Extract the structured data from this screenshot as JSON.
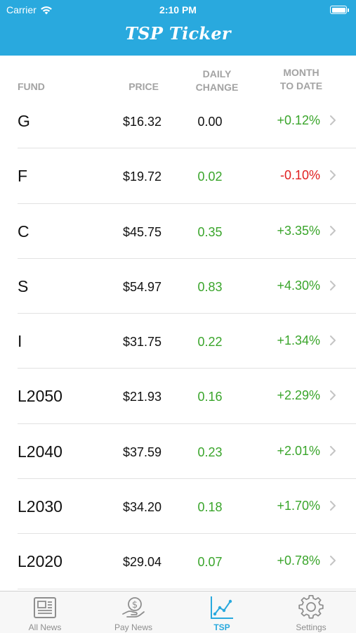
{
  "status_bar": {
    "carrier": "Carrier",
    "time": "2:10 PM"
  },
  "nav": {
    "title": "TSP Ticker"
  },
  "colors": {
    "brand": "#29a9de",
    "positive": "#3aa52b",
    "negative": "#e02020",
    "neutral": "#111111"
  },
  "table": {
    "headers": {
      "fund": "FUND",
      "price": "PRICE",
      "daily_line1": "DAILY",
      "daily_line2": "CHANGE",
      "month_line1": "MONTH",
      "month_line2": "TO DATE"
    },
    "rows": [
      {
        "fund": "G",
        "price": "$16.32",
        "daily": "0.00",
        "daily_trend": "neutral",
        "month": "+0.12%",
        "month_trend": "positive"
      },
      {
        "fund": "F",
        "price": "$19.72",
        "daily": "0.02",
        "daily_trend": "positive",
        "month": "-0.10%",
        "month_trend": "negative"
      },
      {
        "fund": "C",
        "price": "$45.75",
        "daily": "0.35",
        "daily_trend": "positive",
        "month": "+3.35%",
        "month_trend": "positive"
      },
      {
        "fund": "S",
        "price": "$54.97",
        "daily": "0.83",
        "daily_trend": "positive",
        "month": "+4.30%",
        "month_trend": "positive"
      },
      {
        "fund": "I",
        "price": "$31.75",
        "daily": "0.22",
        "daily_trend": "positive",
        "month": "+1.34%",
        "month_trend": "positive"
      },
      {
        "fund": "L2050",
        "price": "$21.93",
        "daily": "0.16",
        "daily_trend": "positive",
        "month": "+2.29%",
        "month_trend": "positive"
      },
      {
        "fund": "L2040",
        "price": "$37.59",
        "daily": "0.23",
        "daily_trend": "positive",
        "month": "+2.01%",
        "month_trend": "positive"
      },
      {
        "fund": "L2030",
        "price": "$34.20",
        "daily": "0.18",
        "daily_trend": "positive",
        "month": "+1.70%",
        "month_trend": "positive"
      },
      {
        "fund": "L2020",
        "price": "$29.04",
        "daily": "0.07",
        "daily_trend": "positive",
        "month": "+0.78%",
        "month_trend": "positive"
      }
    ]
  },
  "tabs": [
    {
      "label": "All News",
      "icon": "newspaper-icon",
      "active": false
    },
    {
      "label": "Pay News",
      "icon": "money-hand-icon",
      "active": false
    },
    {
      "label": "TSP",
      "icon": "line-chart-icon",
      "active": true
    },
    {
      "label": "Settings",
      "icon": "gear-icon",
      "active": false
    }
  ]
}
